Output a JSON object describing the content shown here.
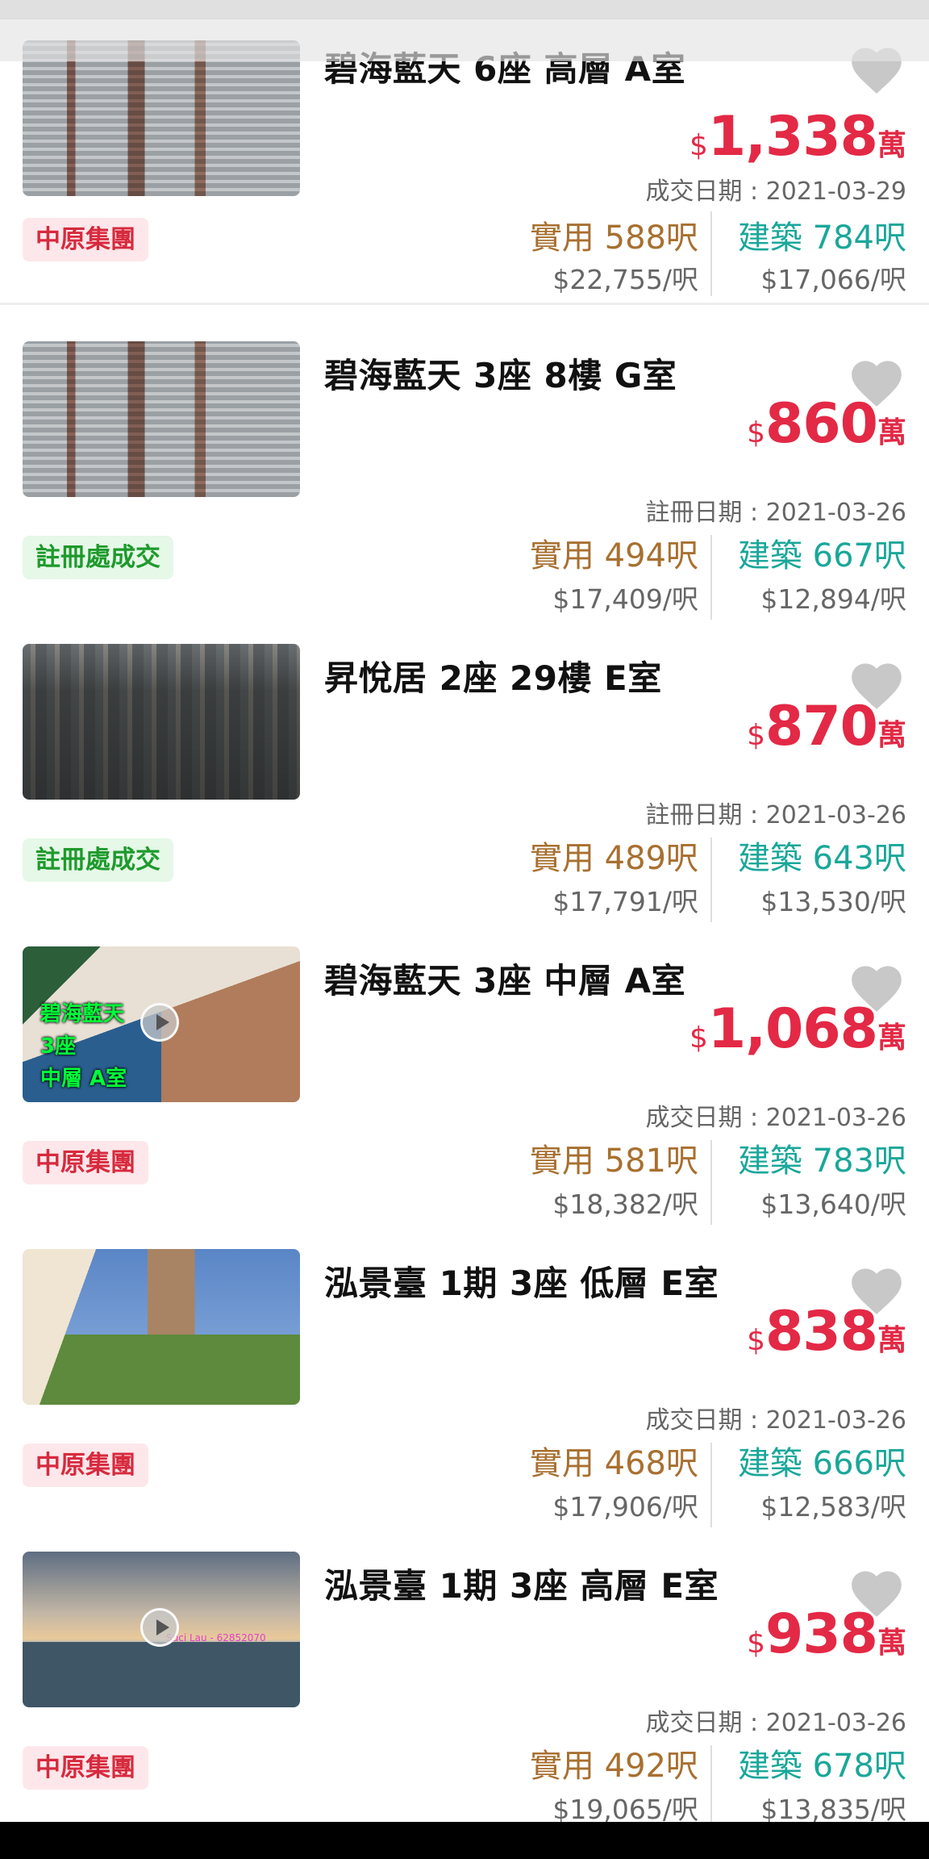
{
  "listings": [
    {
      "title": "碧海藍天 6座 高層 A室",
      "currency": "$",
      "price": "1,338",
      "price_unit": "萬",
      "date_label": "成交日期 : 2021-03-29",
      "agency": "中原集團",
      "saleable": "實用 588呎",
      "saleable_psf": "$22,755/呎",
      "gross": "建築 784呎",
      "gross_psf": "$17,066/呎"
    },
    {
      "title": "碧海藍天 3座 8樓 G室",
      "currency": "$",
      "price": "860",
      "price_unit": "萬",
      "date_label": "註冊日期 : 2021-03-26",
      "agency": "註冊處成交",
      "saleable": "實用 494呎",
      "saleable_psf": "$17,409/呎",
      "gross": "建築 667呎",
      "gross_psf": "$12,894/呎"
    },
    {
      "title": "昇悅居 2座 29樓 E室",
      "currency": "$",
      "price": "870",
      "price_unit": "萬",
      "date_label": "註冊日期 : 2021-03-26",
      "agency": "註冊處成交",
      "saleable": "實用 489呎",
      "saleable_psf": "$17,791/呎",
      "gross": "建築 643呎",
      "gross_psf": "$13,530/呎"
    },
    {
      "title": "碧海藍天 3座 中層 A室",
      "currency": "$",
      "price": "1,068",
      "price_unit": "萬",
      "date_label": "成交日期 : 2021-03-26",
      "agency": "中原集團",
      "saleable": "實用 581呎",
      "saleable_psf": "$18,382/呎",
      "gross": "建築 783呎",
      "gross_psf": "$13,640/呎",
      "thumb_caption_1": "碧海藍天",
      "thumb_caption_2": "3座",
      "thumb_caption_3": "中層 A室"
    },
    {
      "title": "泓景臺 1期 3座 低層 E室",
      "currency": "$",
      "price": "838",
      "price_unit": "萬",
      "date_label": "成交日期 : 2021-03-26",
      "agency": "中原集團",
      "saleable": "實用 468呎",
      "saleable_psf": "$17,906/呎",
      "gross": "建築 666呎",
      "gross_psf": "$12,583/呎"
    },
    {
      "title": "泓景臺 1期 3座 高層 E室",
      "currency": "$",
      "price": "938",
      "price_unit": "萬",
      "date_label": "成交日期 : 2021-03-26",
      "agency": "中原集團",
      "saleable": "實用 492呎",
      "saleable_psf": "$19,065/呎",
      "gross": "建築 678呎",
      "gross_psf": "$13,835/呎",
      "thumb_watermark": "Suci Lau - 62852070"
    }
  ],
  "icons": {
    "favorite": "heart-icon",
    "video": "play-icon"
  },
  "colors": {
    "price": "#e32945",
    "saleable": "#a87030",
    "gross": "#1aa79a",
    "agency_red": "#d72a3e",
    "agency_green": "#1e9a2c",
    "heart": "#c8c8c8"
  }
}
